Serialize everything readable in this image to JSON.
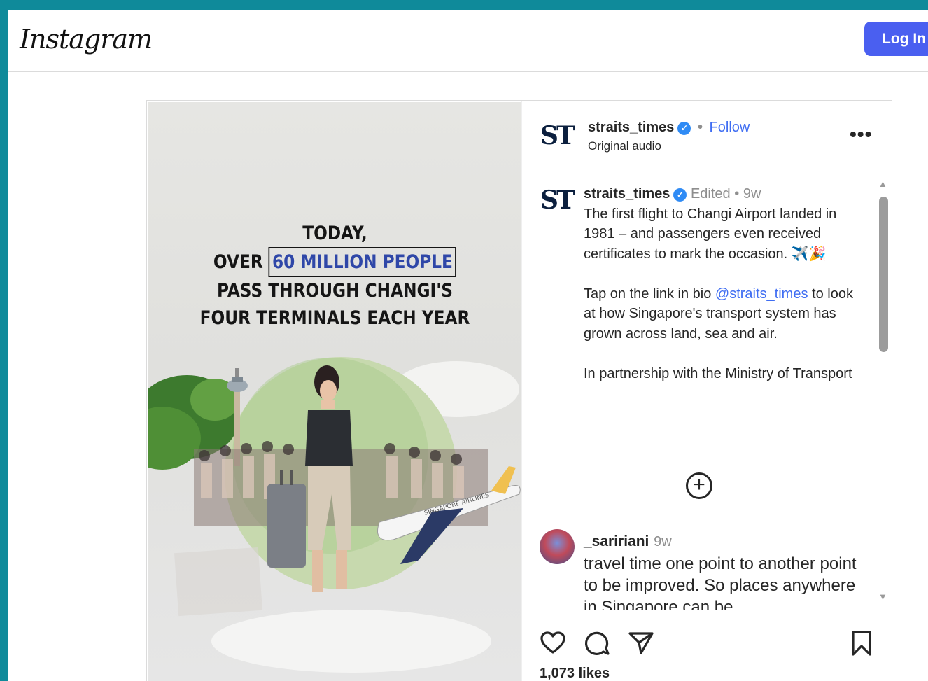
{
  "brand": "Instagram",
  "header": {
    "login_label": "Log In"
  },
  "media": {
    "headline": [
      "TODAY,",
      "OVER",
      "60 MILLION PEOPLE",
      "PASS THROUGH CHANGI'S",
      "FOUR TERMINALS EACH YEAR"
    ],
    "plane_text": "SINGAPORE AIRLINES"
  },
  "post_header": {
    "logo_text": "ST",
    "username": "straits_times",
    "separator": "•",
    "follow_label": "Follow",
    "audio": "Original audio",
    "more_label": "•••"
  },
  "caption": {
    "logo_text": "ST",
    "username": "straits_times",
    "edited": "Edited",
    "separator": "•",
    "time": "9w",
    "text_before_mention": "The first flight to Changi Airport landed in 1981 – and passengers even received certificates to mark the occasion. ✈️🎉\n\nTap on the link in bio ",
    "mention": "@straits_times",
    "text_after_mention": " to look at how Singapore's transport system has grown across land, sea and air.\n\nIn partnership with the Ministry of Transport"
  },
  "load_more_symbol": "+",
  "comments": [
    {
      "username": "_saririani",
      "time": "9w",
      "text": "travel time one point to another point to be improved. So places anywhere in Singapore can be"
    }
  ],
  "likes": "1,073 likes",
  "colors": {
    "background": "#0f8a9a",
    "primary_button": "#4a5ff0",
    "link": "#3f6df2",
    "verified": "#2f8bf5"
  },
  "icons": [
    "heart-icon",
    "comment-icon",
    "share-icon",
    "bookmark-icon",
    "verified-icon",
    "more-options-icon",
    "add-circle-icon"
  ]
}
